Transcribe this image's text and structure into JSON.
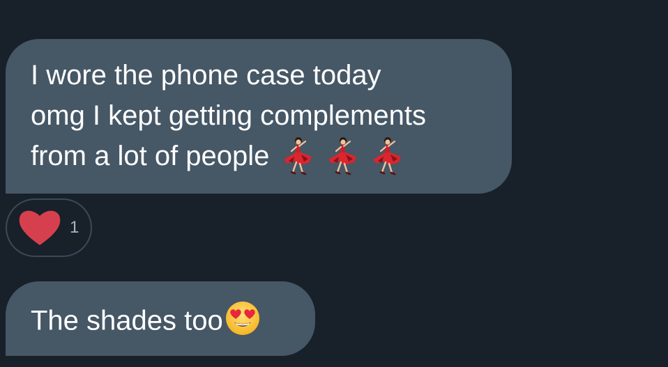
{
  "messages": [
    {
      "lines": [
        "I wore the phone case today",
        "omg I kept getting complements",
        "from a lot of people"
      ],
      "emoji": [
        "dancer-icon",
        "dancer-icon",
        "dancer-icon"
      ]
    },
    {
      "text": "The shades too",
      "emoji": [
        "heart-eyes-icon"
      ]
    }
  ],
  "reaction": {
    "icon": "heart-icon",
    "count": "1"
  },
  "colors": {
    "background": "#18202a",
    "bubble": "#465766",
    "reaction_border": "#3c4a57",
    "heart": "#d6404e",
    "count_text": "#a9b4bf"
  }
}
